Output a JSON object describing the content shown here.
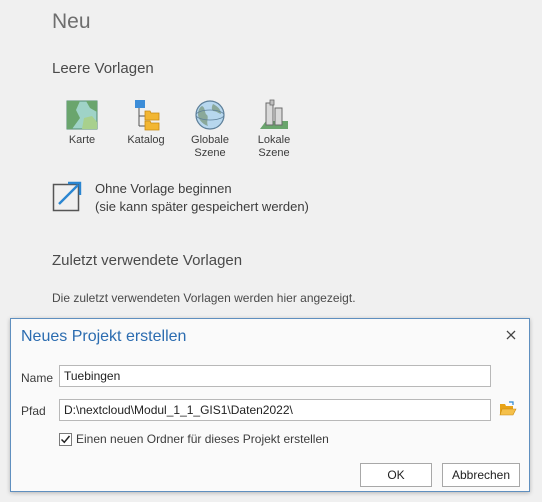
{
  "page": {
    "title": "Neu",
    "empty_templates_heading": "Leere Vorlagen",
    "templates": [
      {
        "label_line1": "Karte",
        "label_line2": "",
        "icon": "map-icon"
      },
      {
        "label_line1": "Katalog",
        "label_line2": "",
        "icon": "catalog-icon"
      },
      {
        "label_line1": "Globale",
        "label_line2": "Szene",
        "icon": "globe-icon"
      },
      {
        "label_line1": "Lokale",
        "label_line2": "Szene",
        "icon": "local-scene-icon"
      }
    ],
    "no_template": {
      "line1": "Ohne Vorlage beginnen",
      "line2": "(sie kann später gespeichert werden)"
    },
    "recent_heading": "Zuletzt verwendete Vorlagen",
    "recent_note": "Die zuletzt verwendeten Vorlagen werden hier angezeigt."
  },
  "dialog": {
    "title": "Neues Projekt erstellen",
    "name_label": "Name",
    "name_value": "Tuebingen",
    "path_label": "Pfad",
    "path_value": "D:\\nextcloud\\Modul_1_1_GIS1\\Daten2022\\",
    "checkbox_label": "Einen neuen Ordner für dieses Projekt erstellen",
    "checkbox_checked": true,
    "ok_label": "OK",
    "cancel_label": "Abbrechen"
  },
  "colors": {
    "accent": "#2b6cb0",
    "folder": "#e8a317"
  }
}
